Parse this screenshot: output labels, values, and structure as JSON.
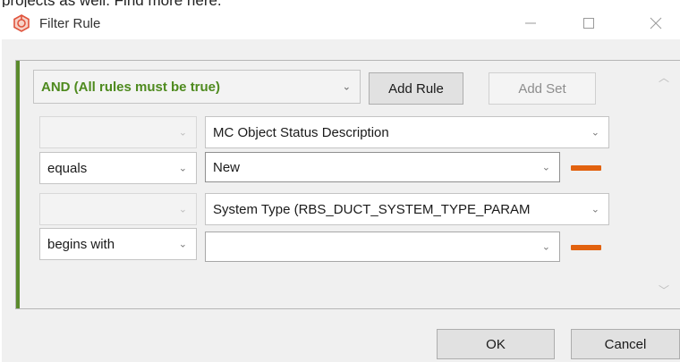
{
  "background_text": "projects as well. Find more here.",
  "window": {
    "title": "Filter Rule",
    "icon": "filter-rule-app-icon",
    "controls": [
      "minimize",
      "maximize",
      "close"
    ]
  },
  "rule_set": {
    "operator": "AND (All rules must be true)",
    "add_rule_label": "Add Rule",
    "add_set_label": "Add Set",
    "rules": [
      {
        "connector": "",
        "field": "MC Object Status Description",
        "condition": "equals",
        "value": "New"
      },
      {
        "connector": "",
        "field": "System Type (RBS_DUCT_SYSTEM_TYPE_PARAM",
        "condition": "begins with",
        "value": ""
      }
    ]
  },
  "footer": {
    "ok_label": "OK",
    "cancel_label": "Cancel"
  },
  "colors": {
    "accent_green": "#5a8a2c",
    "operator_text": "#4e8a1e",
    "remove_rule": "#e2620f"
  }
}
